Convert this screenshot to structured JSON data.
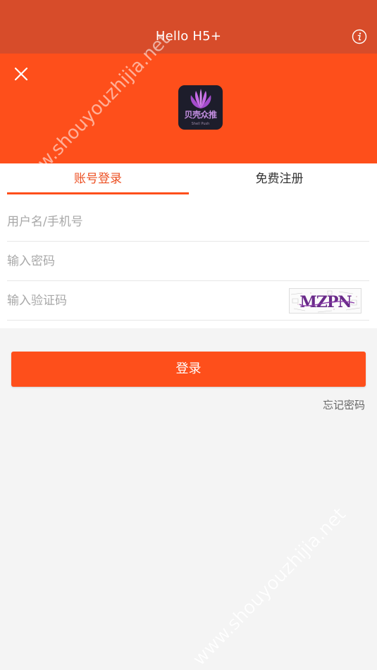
{
  "navbar": {
    "title": "Hello H5+",
    "info_icon": "info-icon"
  },
  "header": {
    "close_icon": "close-icon",
    "logo": {
      "name": "贝壳众推",
      "subtitle": "Shell Push",
      "colors": {
        "background": "#1d1d2b",
        "shell": "#b25fd6"
      }
    }
  },
  "tabs": {
    "login": "账号登录",
    "register": "免费注册"
  },
  "form": {
    "username_placeholder": "用户名/手机号",
    "password_placeholder": "输入密码",
    "captcha_placeholder": "输入验证码",
    "captcha_text": "MZPN"
  },
  "actions": {
    "login_label": "登录",
    "forgot_label": "忘记密码"
  },
  "watermark": {
    "text": "www.shouyouzhijia.net"
  },
  "colors": {
    "navbar": "#d74c2a",
    "accent": "#fe4f1b",
    "background": "#f4f4f4"
  }
}
